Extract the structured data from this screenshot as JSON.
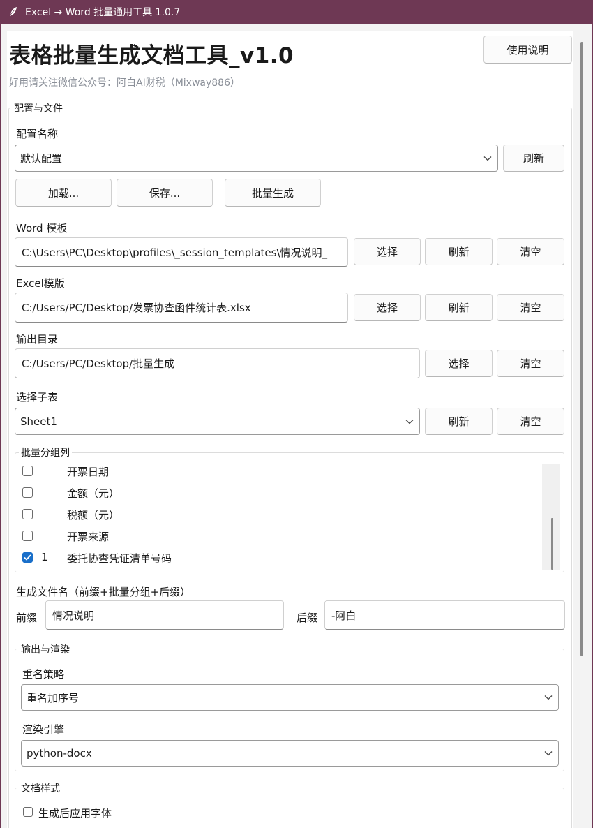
{
  "window": {
    "title": "Excel → Word 批量通用工具 1.0.7"
  },
  "header": {
    "title": "表格批量生成文档工具_v1.0",
    "subtitle": "好用请关注微信公众号：阿白AI财税（Mixway886）",
    "help_button": "使用说明"
  },
  "config_group": {
    "title": "配置与文件",
    "profile_label": "配置名称",
    "profile_value": "默认配置",
    "refresh_label": "刷新",
    "load_label": "加载...",
    "save_label": "保存...",
    "batch_label": "批量生成",
    "word_label": "Word 模板",
    "word_value": "C:\\Users\\PC\\Desktop\\profiles\\_session_templates\\情况说明_",
    "excel_label": "Excel模版",
    "excel_value": "C:/Users/PC/Desktop/发票协查函件统计表.xlsx",
    "output_label": "输出目录",
    "output_value": "C:/Users/PC/Desktop/批量生成",
    "sheet_label": "选择子表",
    "sheet_value": "Sheet1",
    "select_label": "选择",
    "clear_label": "清空"
  },
  "group_columns": {
    "title": "批量分组列",
    "items": [
      {
        "order": "",
        "name": "开票日期",
        "checked": false
      },
      {
        "order": "",
        "name": "金额（元）",
        "checked": false
      },
      {
        "order": "",
        "name": "税额（元）",
        "checked": false
      },
      {
        "order": "",
        "name": "开票来源",
        "checked": false
      },
      {
        "order": "1",
        "name": "委托协查凭证清单号码",
        "checked": true
      }
    ]
  },
  "filename": {
    "title": "生成文件名（前缀+批量分组+后缀）",
    "prefix_label": "前缀",
    "prefix_value": "情况说明",
    "suffix_label": "后缀",
    "suffix_value": "-阿白"
  },
  "render_group": {
    "title": "输出与渲染",
    "rename_label": "重名策略",
    "rename_value": "重名加序号",
    "engine_label": "渲染引擎",
    "engine_value": "python-docx"
  },
  "doc_style": {
    "title": "文档样式",
    "apply_font_label": "生成后应用字体",
    "apply_font_checked": false
  },
  "colors": {
    "titlebar": "#6e3854",
    "accent": "#1a6fc9"
  }
}
